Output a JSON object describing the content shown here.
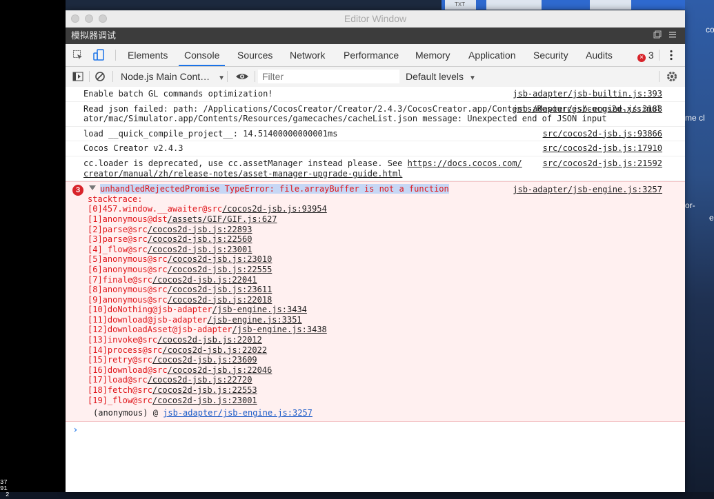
{
  "window": {
    "title": "Editor Window",
    "simulator_label": "模拟器调试"
  },
  "desktop": {
    "right_texts": [
      "co",
      "me cl",
      "or-",
      "e"
    ],
    "top_tile": "TXT",
    "corner_numbers": [
      "37",
      "91",
      "2"
    ]
  },
  "tabs": [
    "Elements",
    "Console",
    "Sources",
    "Network",
    "Performance",
    "Memory",
    "Application",
    "Security",
    "Audits"
  ],
  "error_count": "3",
  "toolbar": {
    "context": "Node.js Main Cont…",
    "filter_placeholder": "Filter",
    "levels": "Default levels"
  },
  "messages": [
    {
      "text": "Enable batch GL commands optimization!",
      "source": "jsb-adapter/jsb-builtin.js:393"
    },
    {
      "text": "Read json failed: path: /Applications/CocosCreator/Creator/2.4.3/CocosCreator.app/Contents/Resources/cocos2d-x/simulator/mac/Simulator.app/Contents/Resources/gamecaches/cacheList.json message: Unexpected end of JSON input",
      "source": "jsb-adapter/jsb-engine.js:3188"
    },
    {
      "text": "load __quick_compile_project__: 14.51400000000001ms",
      "source": "src/cocos2d-jsb.js:93866"
    },
    {
      "text": "Cocos Creator v2.4.3",
      "source": "src/cocos2d-jsb.js:17910"
    },
    {
      "text": "cc.loader is deprecated, use cc.assetManager instead please. See ",
      "link": "https://docs.cocos.com/creator/manual/zh/release-notes/asset-manager-upgrade-guide.html",
      "source": "src/cocos2d-jsb.js:21592"
    }
  ],
  "error": {
    "count": "3",
    "message": "unhandledRejectedPromise TypeError: file.arrayBuffer is not a function",
    "source": "jsb-adapter/jsb-engine.js:3257",
    "stack_label": "stacktrace:",
    "stack": [
      {
        "pre": "[0]457.window.__awaiter@src",
        "link": "/cocos2d-jsb.js:93954"
      },
      {
        "pre": "[1]anonymous@dst",
        "link": "/assets/GIF/GIF.js:627"
      },
      {
        "pre": "[2]parse@src",
        "link": "/cocos2d-jsb.js:22893"
      },
      {
        "pre": "[3]parse@src",
        "link": "/cocos2d-jsb.js:22560"
      },
      {
        "pre": "[4]_flow@src",
        "link": "/cocos2d-jsb.js:23001"
      },
      {
        "pre": "[5]anonymous@src",
        "link": "/cocos2d-jsb.js:23010"
      },
      {
        "pre": "[6]anonymous@src",
        "link": "/cocos2d-jsb.js:22555"
      },
      {
        "pre": "[7]finale@src",
        "link": "/cocos2d-jsb.js:22041"
      },
      {
        "pre": "[8]anonymous@src",
        "link": "/cocos2d-jsb.js:23611"
      },
      {
        "pre": "[9]anonymous@src",
        "link": "/cocos2d-jsb.js:22018"
      },
      {
        "pre": "[10]doNothing@jsb-adapter",
        "link": "/jsb-engine.js:3434"
      },
      {
        "pre": "[11]download@jsb-adapter",
        "link": "/jsb-engine.js:3351"
      },
      {
        "pre": "[12]downloadAsset@jsb-adapter",
        "link": "/jsb-engine.js:3438"
      },
      {
        "pre": "[13]invoke@src",
        "link": "/cocos2d-jsb.js:22012"
      },
      {
        "pre": "[14]process@src",
        "link": "/cocos2d-jsb.js:22022"
      },
      {
        "pre": "[15]retry@src",
        "link": "/cocos2d-jsb.js:23609"
      },
      {
        "pre": "[16]download@src",
        "link": "/cocos2d-jsb.js:22046"
      },
      {
        "pre": "[17]load@src",
        "link": "/cocos2d-jsb.js:22720"
      },
      {
        "pre": "[18]fetch@src",
        "link": "/cocos2d-jsb.js:22553"
      },
      {
        "pre": "[19]_flow@src",
        "link": "/cocos2d-jsb.js:23001"
      }
    ],
    "anon_prefix": "(anonymous) @ ",
    "anon_link": "jsb-adapter/jsb-engine.js:3257"
  },
  "prompt_symbol": "›",
  "colors": {
    "accent": "#1a73e8",
    "error": "#e0151a",
    "error_bg": "#fff0f0"
  }
}
